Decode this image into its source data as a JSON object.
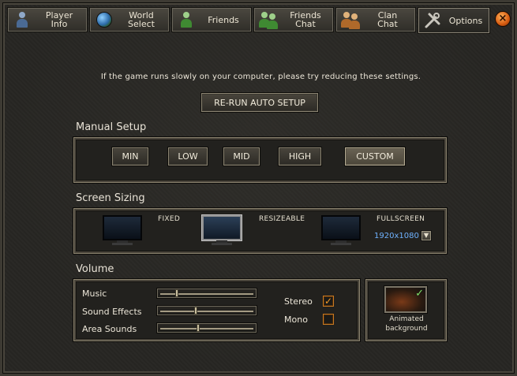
{
  "tabs": [
    {
      "label": "Player\nInfo",
      "icon": "player-info-icon",
      "active": false
    },
    {
      "label": "World\nSelect",
      "icon": "world-select-icon",
      "active": false
    },
    {
      "label": "Friends",
      "icon": "friends-icon",
      "active": false
    },
    {
      "label": "Friends\nChat",
      "icon": "friends-chat-icon",
      "active": false
    },
    {
      "label": "Clan\nChat",
      "icon": "clan-chat-icon",
      "active": false
    },
    {
      "label": "Options",
      "icon": "options-icon",
      "active": true
    }
  ],
  "close_icon": "close-icon",
  "notice": "If the game runs slowly on your computer, please try reducing these settings.",
  "auto_setup_label": "RE-RUN AUTO SETUP",
  "manual_setup": {
    "title": "Manual Setup",
    "presets": [
      "MIN",
      "LOW",
      "MID",
      "HIGH",
      "CUSTOM"
    ],
    "selected": "CUSTOM"
  },
  "screen_sizing": {
    "title": "Screen Sizing",
    "modes": [
      "FIXED",
      "RESIZEABLE",
      "FULLSCREEN"
    ],
    "selected": "RESIZEABLE",
    "resolution": "1920x1080"
  },
  "volume": {
    "title": "Volume",
    "sliders": [
      {
        "label": "Music",
        "value": 0.18
      },
      {
        "label": "Sound Effects",
        "value": 0.38
      },
      {
        "label": "Area Sounds",
        "value": 0.41
      }
    ],
    "stereo_label": "Stereo",
    "stereo_checked": true,
    "mono_label": "Mono",
    "mono_checked": false
  },
  "animated_background": {
    "label": "Animated\nbackground",
    "checked": true
  },
  "colors": {
    "accent_orange": "#f39a2a",
    "resolution_blue": "#6fb2ff"
  }
}
